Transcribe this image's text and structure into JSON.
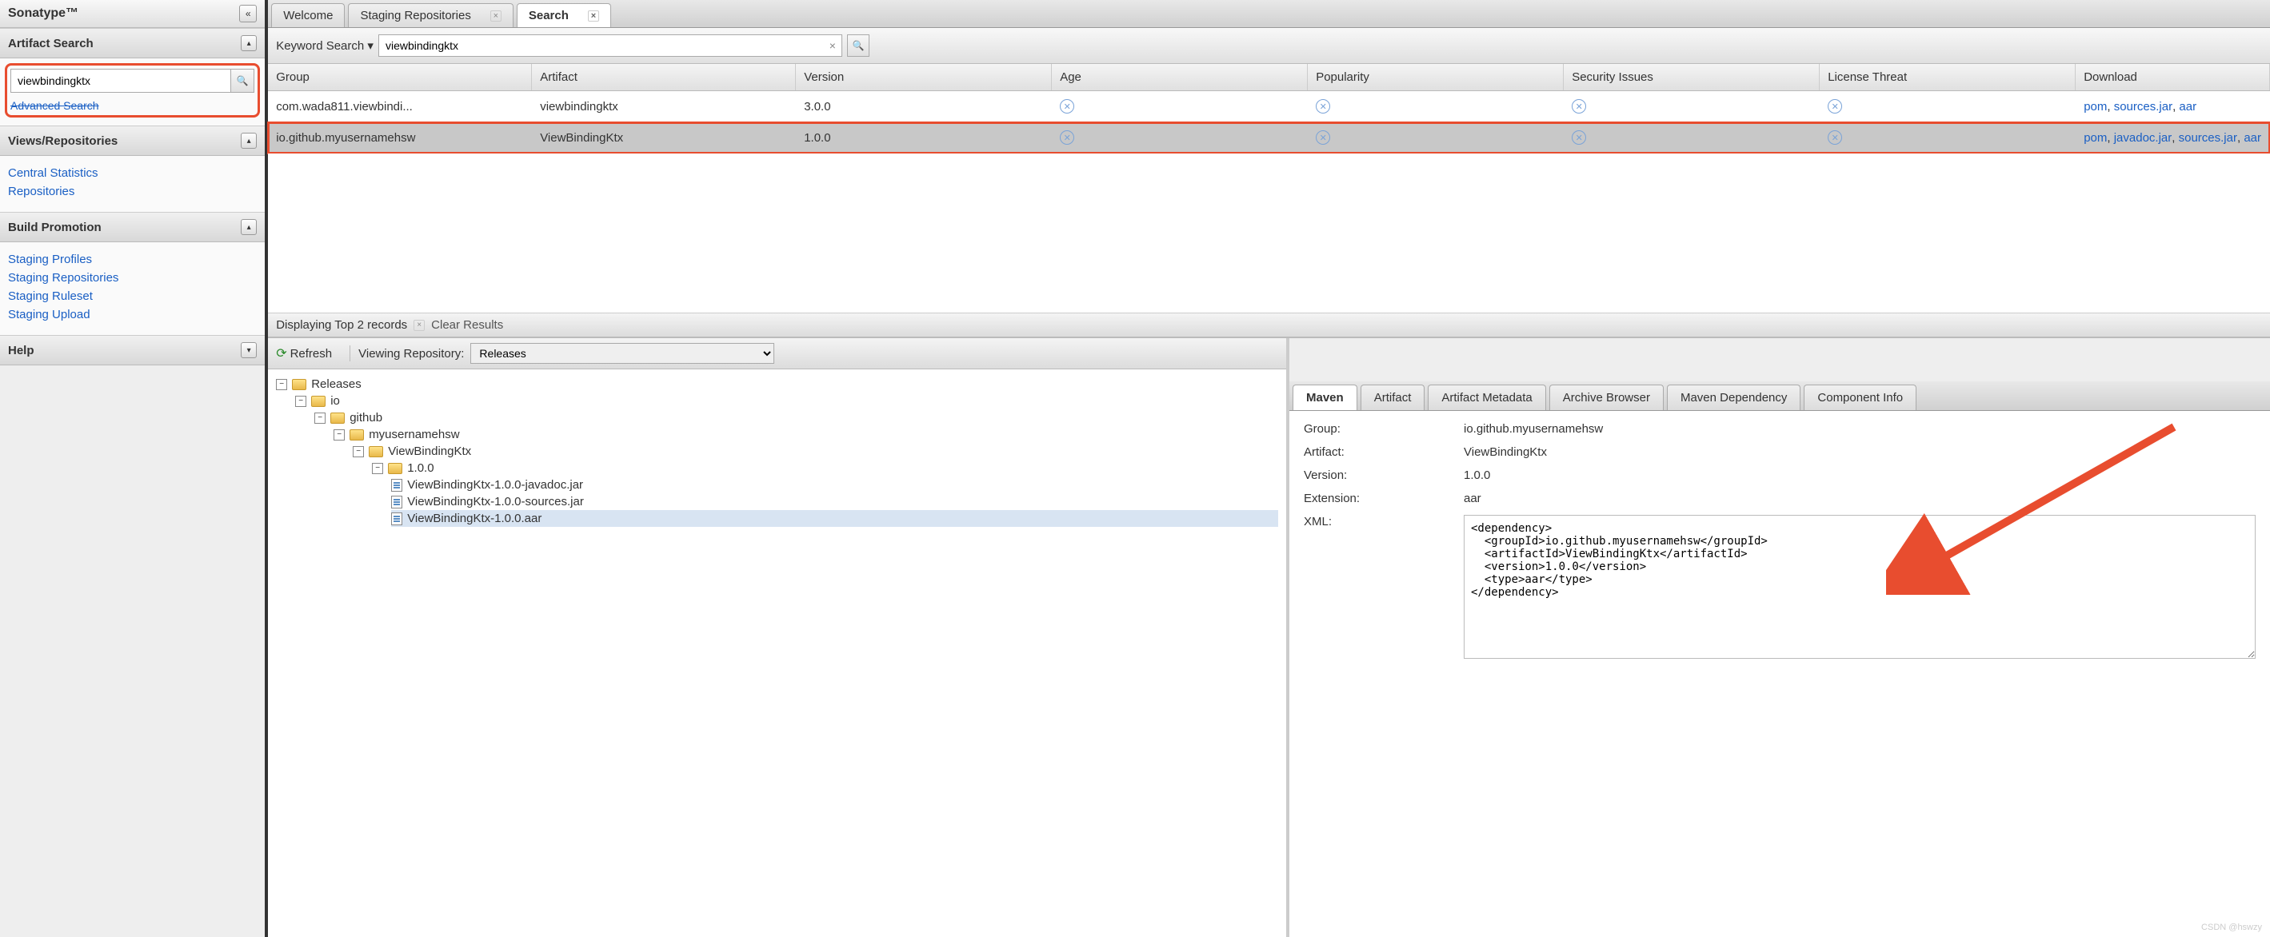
{
  "sidebar": {
    "brand": "Sonatype™",
    "panels": {
      "artifact_search": {
        "title": "Artifact Search",
        "query": "viewbindingktx",
        "advanced_link": "Advanced Search"
      },
      "views": {
        "title": "Views/Repositories",
        "items": [
          "Central Statistics",
          "Repositories"
        ]
      },
      "build": {
        "title": "Build Promotion",
        "items": [
          "Staging Profiles",
          "Staging Repositories",
          "Staging Ruleset",
          "Staging Upload"
        ]
      },
      "help": {
        "title": "Help"
      }
    }
  },
  "tabs": [
    {
      "label": "Welcome",
      "active": false
    },
    {
      "label": "Staging Repositories",
      "active": false
    },
    {
      "label": "Search",
      "active": true
    }
  ],
  "search_bar": {
    "label": "Keyword Search ▾",
    "value": "viewbindingktx"
  },
  "table": {
    "columns": [
      "Group",
      "Artifact",
      "Version",
      "Age",
      "Popularity",
      "Security Issues",
      "License Threat",
      "Download"
    ],
    "rows": [
      {
        "group": "com.wada811.viewbindi...",
        "artifact": "viewbindingktx",
        "version": "3.0.0",
        "downloads": [
          "pom",
          "sources.jar",
          "aar"
        ],
        "selected": false
      },
      {
        "group": "io.github.myusernamehsw",
        "artifact": "ViewBindingKtx",
        "version": "1.0.0",
        "downloads": [
          "pom",
          "javadoc.jar",
          "sources.jar",
          "aar"
        ],
        "selected": true
      }
    ]
  },
  "status": {
    "text": "Displaying Top 2 records",
    "clear": "Clear Results"
  },
  "tree_toolbar": {
    "refresh": "Refresh",
    "label": "Viewing Repository:",
    "repo": "Releases"
  },
  "tree": {
    "root": "Releases",
    "nodes": [
      "io",
      "github",
      "myusernamehsw",
      "ViewBindingKtx",
      "1.0.0"
    ],
    "files": [
      "ViewBindingKtx-1.0.0-javadoc.jar",
      "ViewBindingKtx-1.0.0-sources.jar",
      "ViewBindingKtx-1.0.0.aar"
    ]
  },
  "detail_tabs": [
    "Maven",
    "Artifact",
    "Artifact Metadata",
    "Archive Browser",
    "Maven Dependency",
    "Component Info"
  ],
  "details": {
    "Group:": "io.github.myusernamehsw",
    "Artifact:": "ViewBindingKtx",
    "Version:": "1.0.0",
    "Extension:": "aar",
    "XML:": ""
  },
  "xml": "<dependency>\n  <groupId>io.github.myusernamehsw</groupId>\n  <artifactId>ViewBindingKtx</artifactId>\n  <version>1.0.0</version>\n  <type>aar</type>\n</dependency>",
  "watermark": "CSDN @hswzy"
}
